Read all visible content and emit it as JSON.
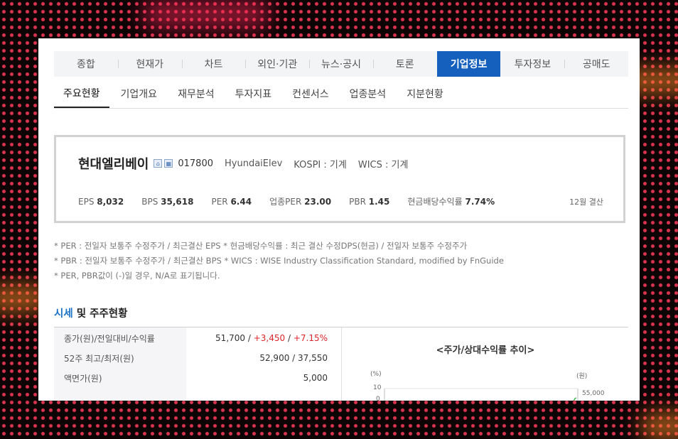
{
  "main_tabs": [
    {
      "label": "종합",
      "active": false
    },
    {
      "label": "현재가",
      "active": false
    },
    {
      "label": "차트",
      "active": false
    },
    {
      "label": "외인·기관",
      "active": false
    },
    {
      "label": "뉴스·공시",
      "active": false
    },
    {
      "label": "토론",
      "active": false
    },
    {
      "label": "기업정보",
      "active": true
    },
    {
      "label": "투자정보",
      "active": false
    },
    {
      "label": "공매도",
      "active": false
    }
  ],
  "sub_tabs": [
    {
      "label": "주요현황",
      "active": true
    },
    {
      "label": "기업개요",
      "active": false
    },
    {
      "label": "재무분석",
      "active": false
    },
    {
      "label": "투자지표",
      "active": false
    },
    {
      "label": "컨센서스",
      "active": false
    },
    {
      "label": "업종분석",
      "active": false
    },
    {
      "label": "지분현황",
      "active": false
    }
  ],
  "company": {
    "name": "현대엘리베이",
    "code": "017800",
    "english_name": "HyundaiElev",
    "market": "KOSPI : 기계",
    "wics": "WICS : 기계",
    "closing": "12월 결산"
  },
  "metrics": [
    {
      "label": "EPS",
      "value": "8,032"
    },
    {
      "label": "BPS",
      "value": "35,618"
    },
    {
      "label": "PER",
      "value": "6.44"
    },
    {
      "label": "업종PER",
      "value": "23.00"
    },
    {
      "label": "PBR",
      "value": "1.45"
    },
    {
      "label": "현금배당수익률",
      "value": "7.74%"
    }
  ],
  "notes": [
    "* PER : 전일자 보통주 수정주가 / 최근결산 EPS * 현금배당수익률 : 최근 결산 수정DPS(현금) / 전일자 보통주 수정주가",
    "* PBR : 전일자 보통주 수정주가 / 최근결산 BPS * WICS : WISE Industry Classification Standard, modified by FnGuide",
    "* PER, PBR값이 (-)일 경우, N/A로 표기됩니다."
  ],
  "section": {
    "title_highlight": "시세",
    "title_rest": " 및 주주현황"
  },
  "price_rows": {
    "close": {
      "label": "종가(원)/전일대비/수익률",
      "price": "51,700",
      "sep1": " / ",
      "change": "+3,450",
      "sep2": " / ",
      "rate": "+7.15%"
    },
    "range": {
      "label": "52주 최고/최저(원)",
      "value": "52,900 / 37,550"
    },
    "face": {
      "label": "액면가(원)",
      "value": "5,000"
    }
  },
  "chart": {
    "title": "<주가/상대수익률 추이>",
    "left_unit": "(%)",
    "right_unit": "(원)",
    "left_ticks": [
      "10",
      "0"
    ],
    "right_ticks": [
      "55,000"
    ]
  },
  "chart_data": {
    "type": "line",
    "title": "<주가/상대수익률 추이>",
    "y_left_label": "(%)",
    "y_right_label": "(원)",
    "y_left_ticks": [
      10,
      0
    ],
    "y_right_ticks": [
      55000
    ],
    "series": []
  },
  "colors": {
    "accent": "#1560bd",
    "up": "#d9262a",
    "highlight": "#1a73c6"
  }
}
